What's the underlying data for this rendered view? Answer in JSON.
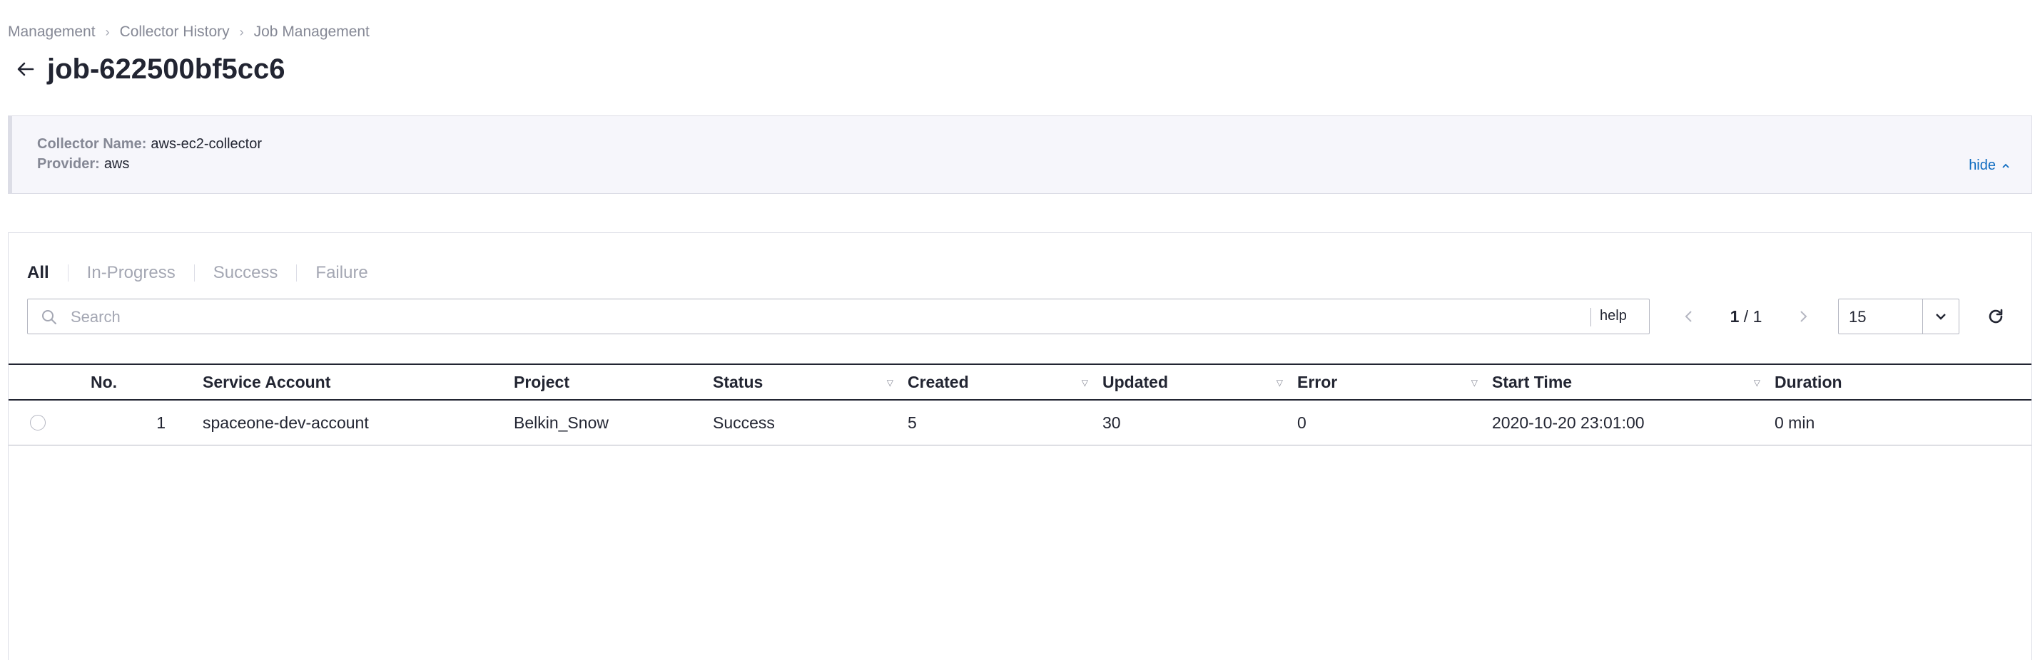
{
  "breadcrumb": [
    "Management",
    "Collector History",
    "Job Management"
  ],
  "page_title": "job-622500bf5cc6",
  "info": {
    "collector_name_label": "Collector Name:",
    "collector_name_value": "aws-ec2-collector",
    "provider_label": "Provider:",
    "provider_value": "aws",
    "hide_label": "hide"
  },
  "tabs": [
    "All",
    "In-Progress",
    "Success",
    "Failure"
  ],
  "search": {
    "placeholder": "Search",
    "help_label": "help"
  },
  "pagination": {
    "current": "1",
    "separator": "/",
    "total": "1"
  },
  "page_size": "15",
  "table": {
    "columns": [
      "No.",
      "Service Account",
      "Project",
      "Status",
      "Created",
      "Updated",
      "Error",
      "Start Time",
      "Duration"
    ],
    "rows": [
      {
        "no": "1",
        "service_account": "spaceone-dev-account",
        "project": "Belkin_Snow",
        "status": "Success",
        "created": "5",
        "updated": "30",
        "error": "0",
        "start_time": "2020-10-20 23:01:00",
        "duration": "0 min"
      }
    ]
  },
  "colors": {
    "link": "#0d6bc0",
    "text": "#222532",
    "muted": "#858895",
    "info_bg": "#f6f6fb"
  }
}
